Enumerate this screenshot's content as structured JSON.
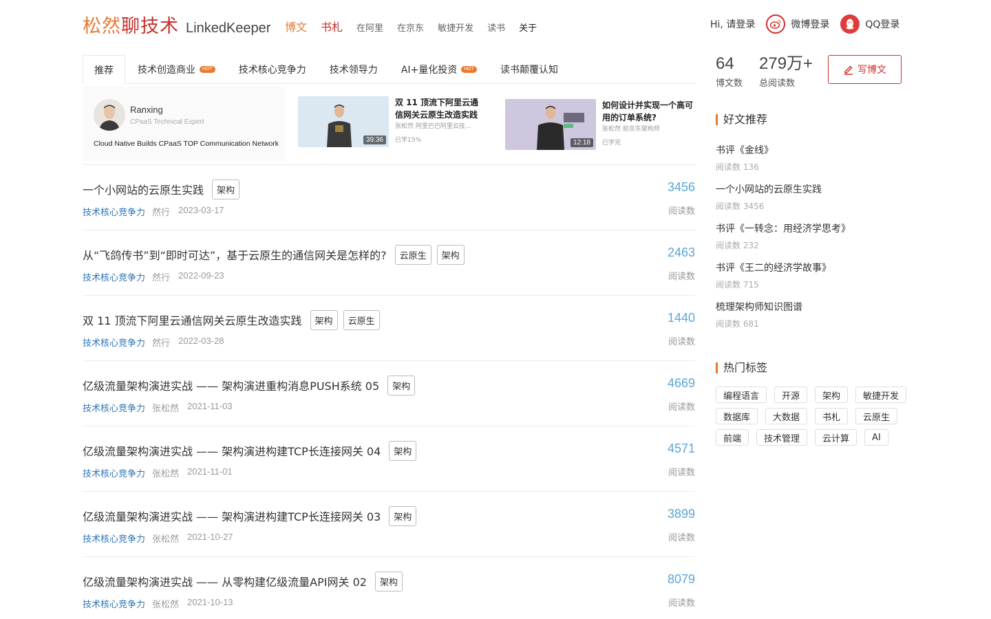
{
  "header": {
    "logo_part1": "松然",
    "logo_part2": "聊技术",
    "logo_en": "LinkedKeeper",
    "nav": [
      {
        "label": "博文"
      },
      {
        "label": "书札"
      },
      {
        "label": "在阿里"
      },
      {
        "label": "在京东"
      },
      {
        "label": "敏捷开发"
      },
      {
        "label": "读书"
      },
      {
        "label": "关于"
      }
    ],
    "greeting": "Hi, 请登录",
    "weibo_login": "微博登录",
    "qq_login": "QQ登录"
  },
  "tabs": [
    {
      "label": "推荐",
      "hot": false
    },
    {
      "label": "技术创造商业",
      "hot": true
    },
    {
      "label": "技术核心竞争力",
      "hot": false
    },
    {
      "label": "技术领导力",
      "hot": false
    },
    {
      "label": "AI+量化投资",
      "hot": true
    },
    {
      "label": "读书颠覆认知",
      "hot": false
    }
  ],
  "hot_label": "HOT",
  "author_card": {
    "name": "Ranxing",
    "role": "CPaaS Technical Expert",
    "desc": "Cloud Native Builds CPaaS TOP Communication Network"
  },
  "videos": [
    {
      "title": "双 11 顶流下阿里云通信网关云原生改造实践",
      "meta": "张松然  阿里巴巴阿里云技...",
      "duration": "39:36",
      "progress": "已学15%"
    },
    {
      "title": "如何设计并实现一个高可用的订单系统?",
      "meta": "张松然  前京东架构师",
      "duration": "12:18",
      "progress": "已学完"
    }
  ],
  "reads_label": "阅读数",
  "articles": [
    {
      "title": "一个小网站的云原生实践",
      "tags": [
        "架构"
      ],
      "category": "技术核心竞争力",
      "author": "然行",
      "date": "2023-03-17",
      "reads": "3456"
    },
    {
      "title": "从“飞鸽传书”到“即时可达”，基于云原生的通信网关是怎样的?",
      "tags": [
        "云原生",
        "架构"
      ],
      "category": "技术核心竞争力",
      "author": "然行",
      "date": "2022-09-23",
      "reads": "2463"
    },
    {
      "title": "双 11 顶流下阿里云通信网关云原生改造实践",
      "tags": [
        "架构",
        "云原生"
      ],
      "category": "技术核心竞争力",
      "author": "然行",
      "date": "2022-03-28",
      "reads": "1440"
    },
    {
      "title": "亿级流量架构演进实战 —— 架构演进重构消息PUSH系统 05",
      "tags": [
        "架构"
      ],
      "category": "技术核心竞争力",
      "author": "张松然",
      "date": "2021-11-03",
      "reads": "4669"
    },
    {
      "title": "亿级流量架构演进实战 —— 架构演进构建TCP长连接网关 04",
      "tags": [
        "架构"
      ],
      "category": "技术核心竞争力",
      "author": "张松然",
      "date": "2021-11-01",
      "reads": "4571"
    },
    {
      "title": "亿级流量架构演进实战 —— 架构演进构建TCP长连接网关 03",
      "tags": [
        "架构"
      ],
      "category": "技术核心竞争力",
      "author": "张松然",
      "date": "2021-10-27",
      "reads": "3899"
    },
    {
      "title": "亿级流量架构演进实战 —— 从零构建亿级流量API网关 02",
      "tags": [
        "架构"
      ],
      "category": "技术核心竞争力",
      "author": "张松然",
      "date": "2021-10-13",
      "reads": "8079"
    }
  ],
  "sidebar": {
    "posts_count": "64",
    "posts_label": "博文数",
    "reads_total": "279万+",
    "reads_total_label": "总阅读数",
    "write_button": "写博文",
    "recommend_title": "好文推荐",
    "recommend": [
      {
        "title": "书评《金线》",
        "reads": "阅读数 136"
      },
      {
        "title": "一个小网站的云原生实践",
        "reads": "阅读数 3456"
      },
      {
        "title": "书评《一转念：用经济学思考》",
        "reads": "阅读数 232"
      },
      {
        "title": "书评《王二的经济学故事》",
        "reads": "阅读数 715"
      },
      {
        "title": "梳理架构师知识图谱",
        "reads": "阅读数 681"
      }
    ],
    "hot_tags_title": "热门标签",
    "hot_tags": [
      "编程语言",
      "开源",
      "架构",
      "敏捷开发",
      "数据库",
      "大数据",
      "书札",
      "云原生",
      "前端",
      "技术管理",
      "云计算",
      "AI"
    ]
  },
  "colors": {
    "brand_orange": "#e8792d",
    "brand_red": "#c9302c",
    "link_blue": "#2e74b5",
    "count_blue": "#5aa6d6"
  }
}
